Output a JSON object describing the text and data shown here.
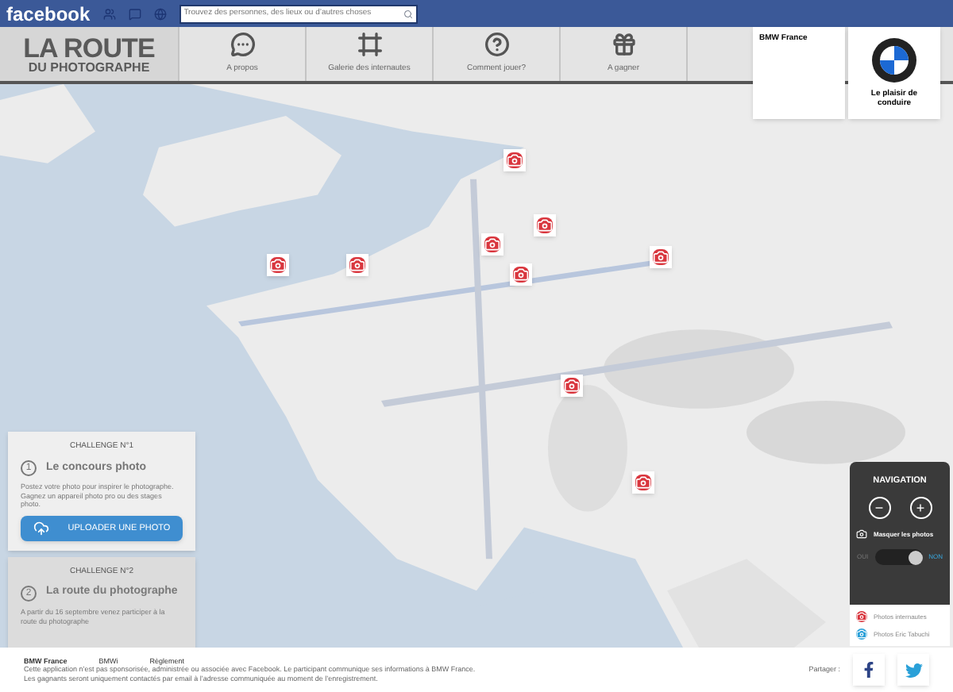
{
  "topbar": {
    "brand": "facebook",
    "search": {
      "placeholder": "Trouvez des personnes, des lieux ou d’autres choses"
    }
  },
  "header": {
    "title": "LA ROUTE",
    "subtitle": "DU PHOTOGRAPHE",
    "nav": [
      {
        "kind": "chat",
        "label": "A propos"
      },
      {
        "kind": "frame",
        "label": "Galerie des internautes"
      },
      {
        "kind": "help",
        "label": "Comment jouer?"
      },
      {
        "kind": "gift",
        "label": "A gagner"
      }
    ]
  },
  "sponsor": {
    "name": "BMW France",
    "slogan": "Le plaisir de conduire"
  },
  "challenges": [
    {
      "heading": "CHALLENGE N°1",
      "number": "1",
      "title": "Le concours photo",
      "text": "Postez votre photo pour inspirer le photographe. Gagnez un appareil photo pro ou des stages photo.",
      "button": "UPLOADER UNE PHOTO",
      "disabled": false
    },
    {
      "heading": "CHALLENGE N°2",
      "number": "2",
      "title": "La route du photographe",
      "text": "A partir du 16 septembre venez participer à la route du photographe",
      "disabled": true
    }
  ],
  "navigation": {
    "title": "NAVIGATION",
    "zoom_out": "−",
    "zoom_in": "+",
    "hide_label": "Masquer les photos",
    "options": [
      {
        "label": "OUI",
        "selected": false
      },
      {
        "label": "NON",
        "selected": true
      }
    ]
  },
  "legend": [
    {
      "label": "Photos internautes",
      "color": "#d9363e"
    },
    {
      "label": "Photos Eric Tabuchi",
      "color": "#2aa0d8"
    }
  ],
  "footer": {
    "links": [
      "BMW France",
      "BMWi",
      "Règlement"
    ],
    "lines": [
      "Cette application n’est pas sponsorisée, administrée ou associée avec Facebook. Le participant communique ses informations à BMW France.",
      "Les gagnants seront uniquement contactés par email à l’adresse communiquée au moment de l’enregistrement."
    ],
    "share": "Partager :"
  }
}
